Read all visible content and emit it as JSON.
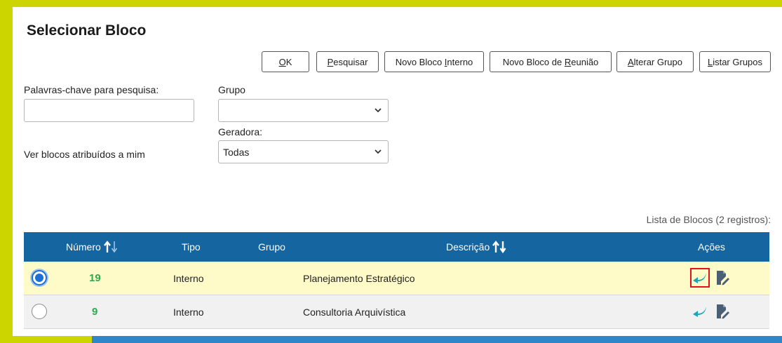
{
  "page": {
    "title": "Selecionar Bloco"
  },
  "toolbar": [
    {
      "name": "ok-button",
      "key": "O",
      "rest": "K"
    },
    {
      "name": "pesquisar-button",
      "key": "P",
      "rest": "esquisar"
    },
    {
      "name": "novo-bloco-interno-button",
      "pre": "Novo Bloco ",
      "key": "I",
      "rest": "nterno"
    },
    {
      "name": "novo-bloco-reuniao-button",
      "pre": "Novo Bloco de ",
      "key": "R",
      "rest": "eunião"
    },
    {
      "name": "alterar-grupo-button",
      "key": "A",
      "rest": "lterar Grupo"
    },
    {
      "name": "listar-grupos-button",
      "key": "L",
      "rest": "istar Grupos"
    }
  ],
  "filters": {
    "keywords_label": "Palavras-chave para pesquisa:",
    "keywords_value": "",
    "grupo_label": "Grupo",
    "grupo_value": "",
    "geradora_label": "Geradora:",
    "geradora_value": "Todas",
    "assigned_label": "Ver blocos atribuídos a mim"
  },
  "list": {
    "caption": "Lista de Blocos (2 registros):",
    "headers": {
      "numero": "Número",
      "tipo": "Tipo",
      "grupo": "Grupo",
      "descricao": "Descrição",
      "acoes": "Ações"
    },
    "rows": [
      {
        "numero": "19",
        "tipo": "Interno",
        "grupo": "",
        "descricao": "Planejamento Estratégico",
        "selected": true
      },
      {
        "numero": "9",
        "tipo": "Interno",
        "grupo": "",
        "descricao": "Consultoria Arquivística",
        "selected": false
      }
    ]
  },
  "icons": {
    "sort": "sort-arrows-icon",
    "return": "return-arrow-icon",
    "edit": "edit-document-icon",
    "chevron": "chevron-down-icon"
  },
  "colors": {
    "header_bg": "#1565a0",
    "selected_row": "#fffbc8",
    "number": "#2fa84f",
    "accent": "#cdd500",
    "action_teal": "#17a9b7",
    "highlight": "#e0141e"
  }
}
